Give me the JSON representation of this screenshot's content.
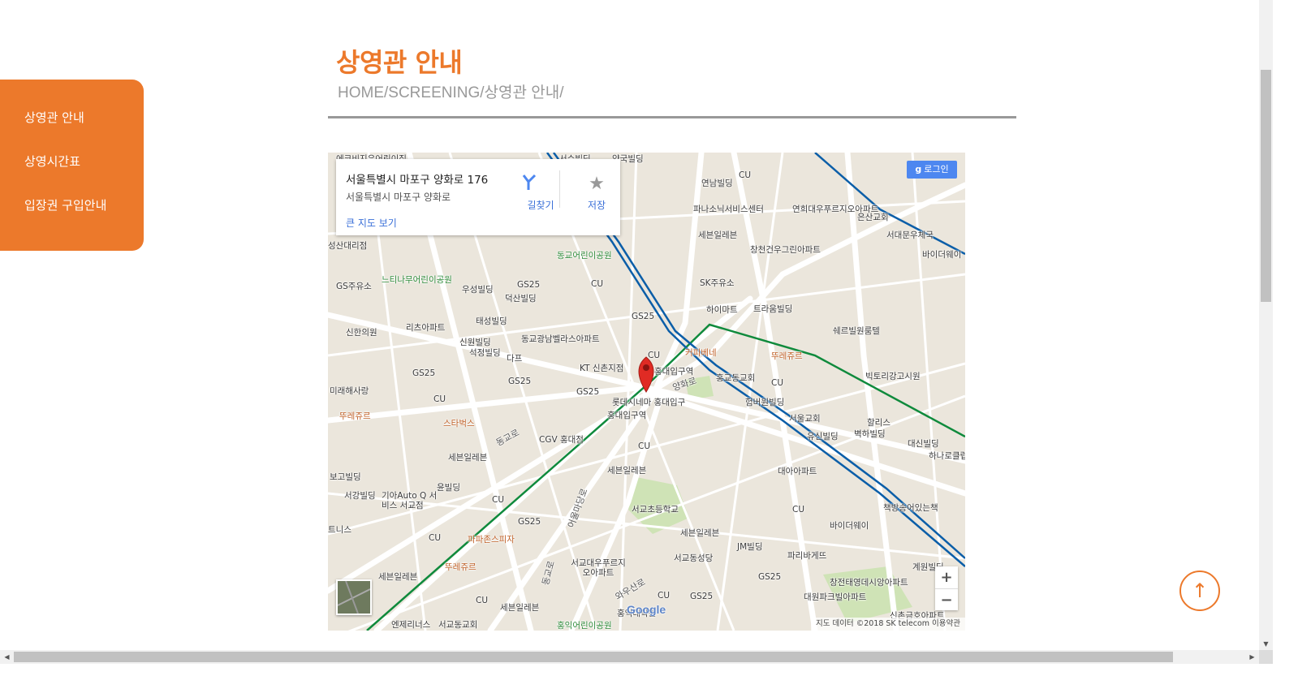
{
  "sidebar": {
    "items": [
      {
        "label": "상영관 안내"
      },
      {
        "label": "상영시간표"
      },
      {
        "label": "입장권 구입안내"
      }
    ]
  },
  "header": {
    "title": "상영관 안내",
    "breadcrumb": "HOME/SCREENING/상영관 안내/"
  },
  "map": {
    "card": {
      "address_title": "서울특별시 마포구 양화로 176",
      "address_sub": "서울특별시 마포구 양화로",
      "big_map_link": "큰 지도 보기",
      "directions_label": "길찾기",
      "save_label": "저장"
    },
    "login_label": "로그인",
    "zoom_in": "+",
    "zoom_out": "−",
    "attribution": "지도 데이터 ©2018 SK telecom    이용약관",
    "logo": "Google",
    "labels": [
      "에코비지우어린이집",
      "서수빌딩",
      "약국빌딩",
      "연남빌딩",
      "CU",
      "연희대우푸르지오아파트",
      "은산교회",
      "서대문우체국",
      "바이더웨이",
      "파나소닉서비스센터",
      "세븐일레븐",
      "창천건우그린아파트",
      "동교어린이공원",
      "성산대리점",
      "GS주유소",
      "느티나무어린이공원",
      "우성빌딩",
      "GS25",
      "덕산빌딩",
      "CU",
      "SK주유소",
      "하이마트",
      "트라움빌딩",
      "쉐르빌원룸텔",
      "태성빌딩",
      "리츠아파트",
      "신한의원",
      "GS25",
      "동교광남벨라스아파트",
      "신원빌딩",
      "석정빌딩",
      "다프",
      "CU",
      "커피베네",
      "뚜레쥬르",
      "KT 신촌지점",
      "홍대입구역",
      "홍교동교회",
      "CU",
      "빅토리강고시원",
      "GS25",
      "GS25",
      "GS25",
      "양화로",
      "롯데시네마 홍대입구",
      "홍대입구역",
      "험버원빌딩",
      "서울교회",
      "할리스",
      "벽하빌딩",
      "대신빌딩",
      "하나로클럽",
      "미래해사랑",
      "CU",
      "뚜레쥬르",
      "스타벅스",
      "동교로",
      "CGV 홍대점",
      "유신빌딩",
      "세븐일레븐",
      "CU",
      "세븐일레븐",
      "대아아파트",
      "보고빌딩",
      "윤빌딩",
      "서강빌딩",
      "기아Auto Q 서비스 서교점",
      "CU",
      "서교초등학교",
      "CU",
      "책방송어있는책",
      "바이더웨이",
      "트니스",
      "GS25",
      "세븐일레븐",
      "JM빌딩",
      "CU",
      "파파존스피자",
      "서교동성당",
      "파리바게뜨",
      "계원빌딩",
      "뚜레쥬르",
      "서교대우푸르지오아파트",
      "GS25",
      "창전태영데시앙아파트",
      "세븐일레븐",
      "CU",
      "CU",
      "GS25",
      "대원파크빌아파트",
      "신촌금호아파트",
      "엔제리너스",
      "서교동교회",
      "세븐일레븐",
      "홍익어린이공원",
      "홍익대학원",
      "와우산로",
      "어울마당로",
      "동교로"
    ]
  },
  "top_button": "↑",
  "colors": {
    "accent": "#ec792b",
    "breadcrumb": "#999999",
    "subway_green": "#0f8a3c",
    "subway_blue": "#0b5ea8"
  }
}
